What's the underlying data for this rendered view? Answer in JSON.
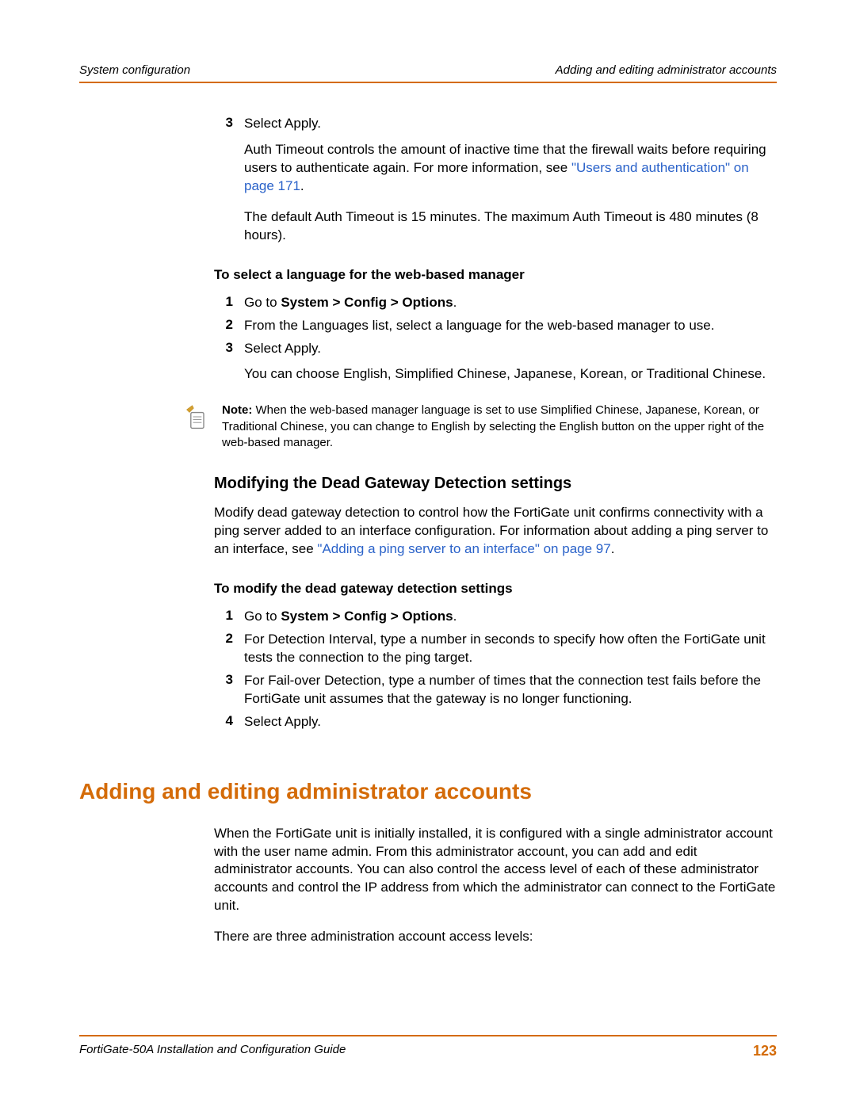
{
  "header": {
    "left": "System configuration",
    "right": "Adding and editing administrator accounts"
  },
  "section_top": {
    "step3_num": "3",
    "step3_text": "Select Apply.",
    "para1_pre": "Auth Timeout controls the amount of inactive time that the firewall waits before requiring users to authenticate again. For more information, see ",
    "para1_link": "\"Users and authentication\" on page 171",
    "para1_post": ".",
    "para2": "The default Auth Timeout is 15 minutes. The maximum Auth Timeout is 480 minutes (8 hours)."
  },
  "lang": {
    "title": "To select a language for the web-based manager",
    "s1_num": "1",
    "s1_pre": "Go to ",
    "s1_bold": "System > Config > Options",
    "s1_post": ".",
    "s2_num": "2",
    "s2_text": "From the Languages list, select a language for the web-based manager to use.",
    "s3_num": "3",
    "s3_text": "Select Apply.",
    "para": "You can choose English, Simplified Chinese, Japanese, Korean, or Traditional Chinese."
  },
  "note": {
    "label": "Note:",
    "text": " When the web-based manager language is set to use Simplified Chinese, Japanese, Korean, or Traditional Chinese, you can change to English by selecting the English button on the upper right of the web-based manager."
  },
  "dead_gw": {
    "h3": "Modifying the Dead Gateway Detection settings",
    "intro_pre": "Modify dead gateway detection to control how the FortiGate unit confirms connectivity with a ping server added to an interface configuration. For information about adding a ping server to an interface, see ",
    "intro_link": "\"Adding a ping server to an interface\" on page 97",
    "intro_post": ".",
    "sub": "To modify the dead gateway detection settings",
    "s1_num": "1",
    "s1_pre": "Go to ",
    "s1_bold": "System > Config > Options",
    "s1_post": ".",
    "s2_num": "2",
    "s2_text": "For Detection Interval, type a number in seconds to specify how often the FortiGate unit tests the connection to the ping target.",
    "s3_num": "3",
    "s3_text": "For Fail-over Detection, type a number of times that the connection test fails before the FortiGate unit assumes that the gateway is no longer functioning.",
    "s4_num": "4",
    "s4_text": "Select Apply."
  },
  "admin": {
    "h1": "Adding and editing administrator accounts",
    "p1": "When the FortiGate unit is initially installed, it is configured with a single administrator account with the user name admin. From this administrator account, you can add and edit administrator accounts. You can also control the access level of each of these administrator accounts and control the IP address from which the administrator can connect to the FortiGate unit.",
    "p2": "There are three administration account access levels:"
  },
  "footer": {
    "left": "FortiGate-50A Installation and Configuration Guide",
    "right": "123"
  }
}
